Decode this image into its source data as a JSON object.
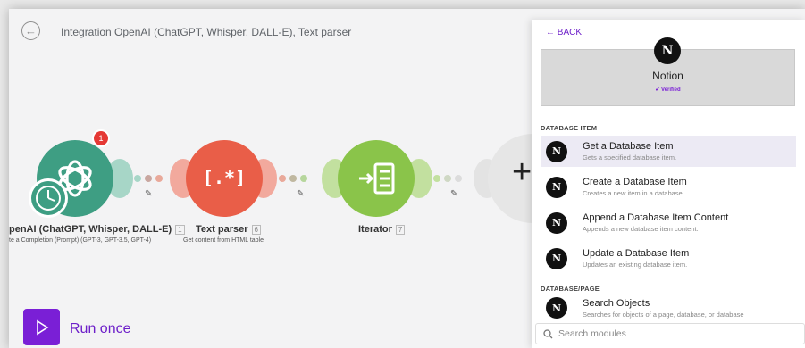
{
  "header": {
    "title": "Integration OpenAI (ChatGPT, Whisper, DALL-E), Text parser"
  },
  "modules": [
    {
      "name": "penAI (ChatGPT, Whisper, DALL-E)",
      "number": "1",
      "subtitle": "te a Completion (Prompt) (GPT-3, GPT-3.5, GPT-4)",
      "color": "#3e9e83",
      "badge": "1"
    },
    {
      "name": "Text parser",
      "number": "6",
      "subtitle": "Get content from HTML table",
      "color": "#e95e48"
    },
    {
      "name": "Iterator",
      "number": "7",
      "subtitle": "",
      "color": "#8ac44a"
    }
  ],
  "run": {
    "label": "Run once"
  },
  "panel": {
    "back_label": "← BACK",
    "app_name": "Notion",
    "verified": "✔ Verified",
    "sections": [
      {
        "title": "DATABASE ITEM",
        "items": [
          {
            "title": "Get a Database Item",
            "desc": "Gets a specified database item."
          },
          {
            "title": "Create a Database Item",
            "desc": "Creates a new item in a database."
          },
          {
            "title": "Append a Database Item Content",
            "desc": "Appends a new database item content."
          },
          {
            "title": "Update a Database Item",
            "desc": "Updates an existing database item."
          }
        ]
      },
      {
        "title": "DATABASE/PAGE",
        "items": [
          {
            "title": "Search Objects",
            "desc": "Searches for objects of a page, database, or database"
          }
        ]
      }
    ],
    "search_placeholder": "Search modules"
  },
  "colors": {
    "accent": "#6d1fc9",
    "openai_green": "#3e9e83",
    "text_parser_red": "#e95e48",
    "iterator_green": "#8ac44a"
  }
}
